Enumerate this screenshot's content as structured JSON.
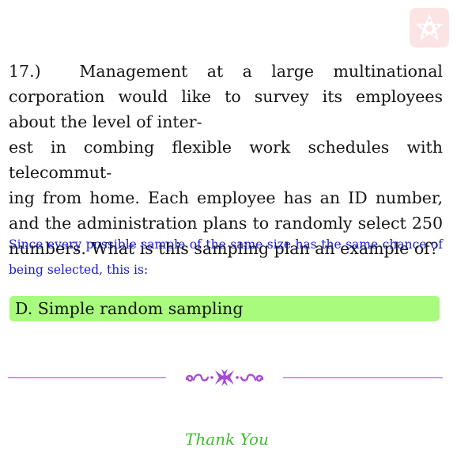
{
  "logo": {
    "icon": "star-flower-logo-icon",
    "color": "#fde4e4"
  },
  "question": {
    "number": "17.)",
    "text_parts": [
      "Management at a large multinational corporation would like to survey its employees about the level of inter",
      "est in combing flexible work schedules with telecommut",
      "ing from home.  Each employee has an ID number, and the administration plans to randomly select 250 numbers. What is this sampling plan an example of?"
    ]
  },
  "answer": {
    "intro": "Since every possible sample of the same size has the same chance of being selected, this is:",
    "choice": "D. Simple random sampling",
    "highlight_color": "#a8fb7c"
  },
  "divider": {
    "icon": "ornamental-flourish-icon",
    "color": "#a74ad6"
  },
  "footer": {
    "thanks": "Thank You",
    "color": "#3fbd2f"
  }
}
